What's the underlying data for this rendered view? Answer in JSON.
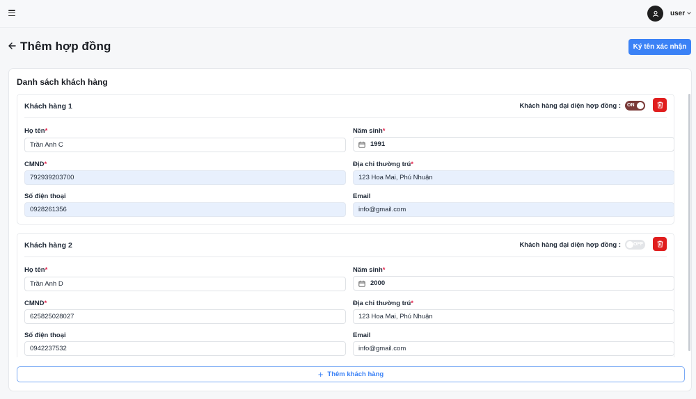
{
  "header": {
    "username": "user"
  },
  "page": {
    "title": "Thêm hợp đồng",
    "sign_label": "Ký tên xác nhận"
  },
  "customer_list": {
    "title": "Danh sách khách hàng",
    "add_label": "Thêm khách hàng",
    "customers": [
      {
        "title": "Khách hàng 1",
        "rep_label": "Khách hàng đại diện hợp đồng :",
        "rep_toggle": "ON",
        "labels": {
          "name": "Họ tên",
          "birth": "Năm sinh",
          "id": "CMND",
          "address": "Địa chỉ thường trú",
          "phone": "Số điện thoại",
          "email": "Email"
        },
        "name": "Trần Anh C",
        "birth_year": "1991",
        "id_number": "792939203700",
        "address": "123 Hoa Mai, Phú Nhuận",
        "phone": "0928261356",
        "email": "info@gmail.com"
      },
      {
        "title": "Khách hàng 2",
        "rep_label": "Khách hàng đại diện hợp đồng :",
        "rep_toggle": "OFF",
        "labels": {
          "name": "Họ tên",
          "birth": "Năm sinh",
          "id": "CMND",
          "address": "Địa chỉ thường trú",
          "phone": "Số điện thoại",
          "email": "Email"
        },
        "name": "Trần Anh D",
        "birth_year": "2000",
        "id_number": "625825028027",
        "address": "123 Hoa Mai, Phú Nhuận",
        "phone": "0942237532",
        "email": "info@gmail.com"
      }
    ]
  },
  "colors": {
    "primary": "#3b82f6",
    "danger": "#e01e1e",
    "toggle_on": "#7a3a38",
    "filled_input": "#e8f0fd"
  },
  "icons": [
    "menu-icon",
    "user-icon",
    "chevron-down-icon",
    "arrow-left-icon",
    "trash-icon",
    "calendar-icon",
    "plus-icon"
  ]
}
